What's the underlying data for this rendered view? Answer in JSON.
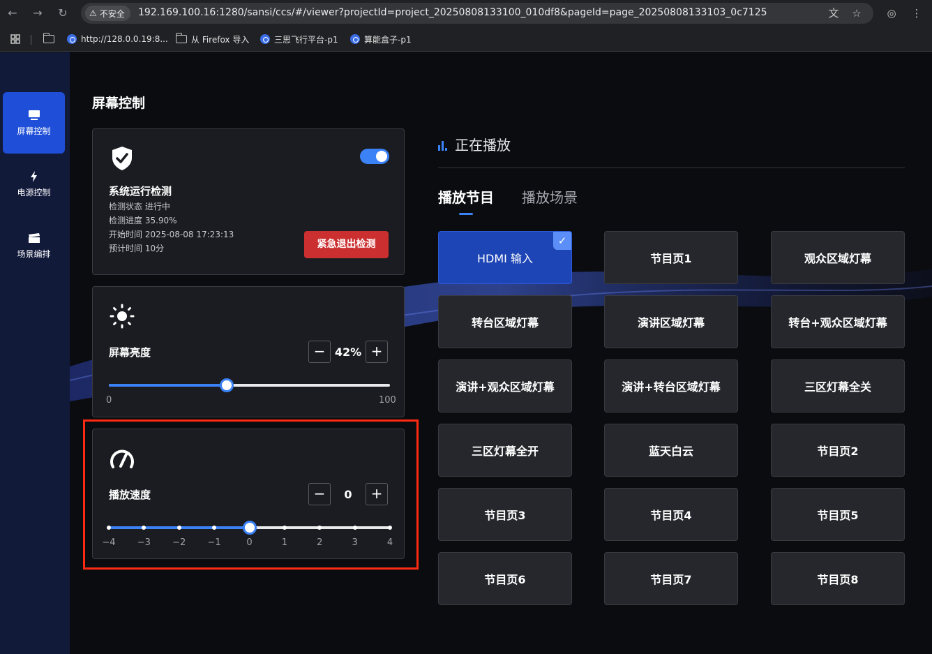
{
  "browser": {
    "security_label": "不安全",
    "url": "192.169.100.16:1280/sansi/ccs/#/viewer?projectId=project_20250808133100_010df8&pageId=page_20250808133103_0c7125",
    "bookmarks": [
      "http://128.0.0.19:8...",
      "从 Firefox 导入",
      "三思飞行平台-p1",
      "算能盒子-p1"
    ]
  },
  "sidebar": {
    "items": [
      {
        "label": "屏幕控制",
        "icon": "monitor-icon",
        "active": true
      },
      {
        "label": "电源控制",
        "icon": "lightning-icon",
        "active": false
      },
      {
        "label": "场景编排",
        "icon": "clapperboard-icon",
        "active": false
      }
    ]
  },
  "page": {
    "title": "屏幕控制"
  },
  "detection": {
    "title": "系统运行检测",
    "enabled": true,
    "status_line": "检测状态 进行中",
    "progress_line": "检测进度 35.90%",
    "start_line": "开始时间 2025-08-08 17:23:13",
    "eta_line": "预计时间 10分",
    "exit_button": "紧急退出检测"
  },
  "brightness": {
    "label": "屏幕亮度",
    "value_text": "42%",
    "value": 42,
    "min_label": "0",
    "max_label": "100",
    "minus": "−",
    "plus": "+"
  },
  "speed": {
    "label": "播放速度",
    "value_text": "0",
    "value": 0,
    "scale": [
      "−4",
      "−3",
      "−2",
      "−1",
      "0",
      "1",
      "2",
      "3",
      "4"
    ],
    "minus": "−",
    "plus": "+"
  },
  "playing": {
    "header": "正在播放",
    "tabs": [
      {
        "label": "播放节目",
        "active": true
      },
      {
        "label": "播放场景",
        "active": false
      }
    ],
    "selected_check": "✓",
    "programs": [
      {
        "label": "HDMI 输入",
        "selected": true
      },
      {
        "label": "节目页1"
      },
      {
        "label": "观众区域灯幕"
      },
      {
        "label": "转台区域灯幕"
      },
      {
        "label": "演讲区域灯幕"
      },
      {
        "label": "转台+观众区域灯幕"
      },
      {
        "label": "演讲+观众区域灯幕"
      },
      {
        "label": "演讲+转台区域灯幕"
      },
      {
        "label": "三区灯幕全关"
      },
      {
        "label": "三区灯幕全开"
      },
      {
        "label": "蓝天白云"
      },
      {
        "label": "节目页2"
      },
      {
        "label": "节目页3"
      },
      {
        "label": "节目页4"
      },
      {
        "label": "节目页5"
      },
      {
        "label": "节目页6"
      },
      {
        "label": "节目页7"
      },
      {
        "label": "节目页8"
      }
    ]
  },
  "colors": {
    "accent": "#3b82f6",
    "sidebar_active": "#1f4fd8",
    "danger": "#cc2f2f",
    "highlight": "#ff2a12"
  }
}
